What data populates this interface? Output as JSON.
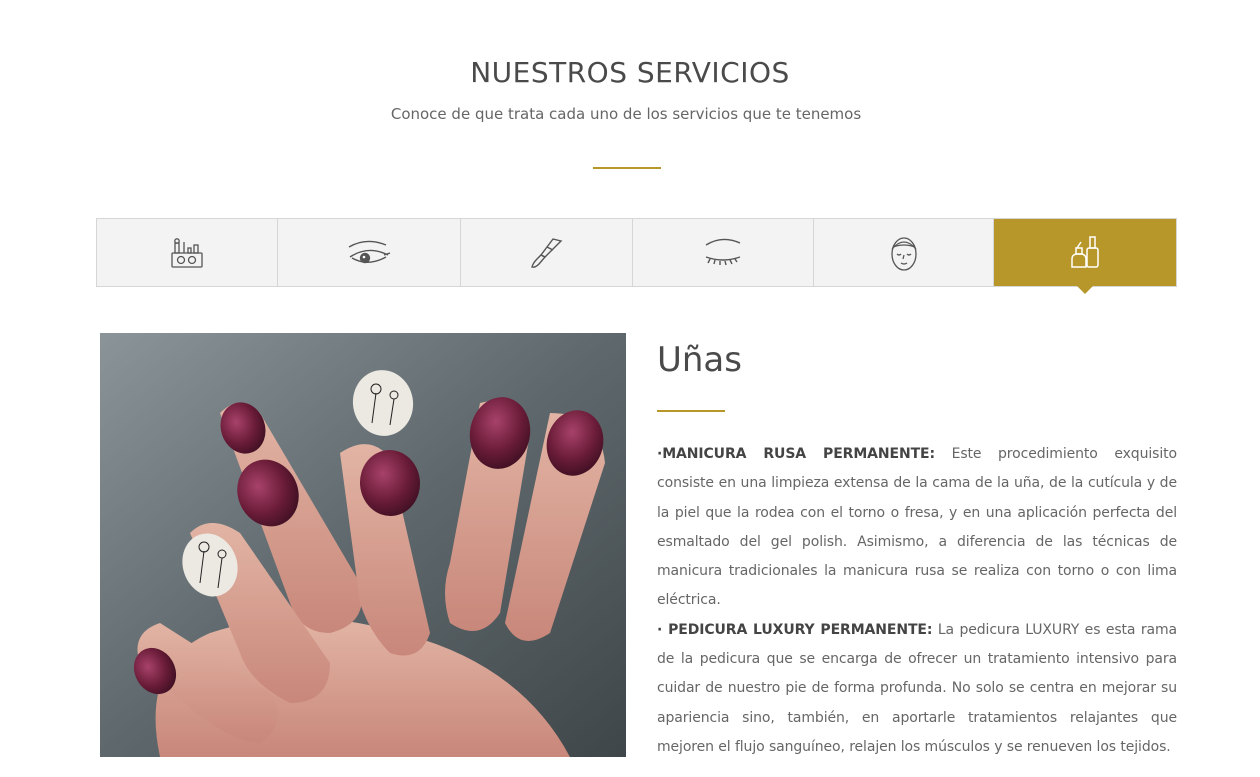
{
  "header": {
    "title": "NUESTROS SERVICIOS",
    "subtitle": "Conoce de que trata cada uno de los servicios que te tenemos"
  },
  "tabs": [
    {
      "icon": "makeup-kit-icon",
      "active": false
    },
    {
      "icon": "eyeliner-eye-icon",
      "active": false
    },
    {
      "icon": "makeup-brush-icon",
      "active": false
    },
    {
      "icon": "eyelash-icon",
      "active": false
    },
    {
      "icon": "facial-treatment-icon",
      "active": false
    },
    {
      "icon": "nail-polish-icon",
      "active": true
    }
  ],
  "colors": {
    "accent": "#b8972a",
    "tab_bg": "#f3f3f3",
    "tab_border": "#d6d6d6",
    "heading": "#4a4a4a",
    "text": "#666666"
  },
  "service": {
    "image_alt": "manicured-nails-photo",
    "title": "Uñas",
    "items": [
      {
        "label": "·MANICURA RUSA PERMANENTE:",
        "text": " Este procedimiento exquisito consiste en una limpieza extensa de la cama de la uña, de la cutícula y de la piel que la rodea con el torno o fresa, y en una aplicación perfecta del esmaltado del gel polish. Asimismo, a diferencia de las técnicas de manicura tradicionales la manicura rusa se realiza con torno o con lima eléctrica."
      },
      {
        "label": "· PEDICURA LUXURY PERMANENTE:",
        "text": " La pedicura LUXURY es esta rama de la pedicura que se encarga de ofrecer un tratamiento intensivo para cuidar de nuestro pie de forma profunda. No solo se centra en mejorar su apariencia sino, también, en aportarle tratamientos relajantes que mejoren el flujo sanguíneo, relajen los músculos y se renueven los tejidos."
      }
    ]
  }
}
